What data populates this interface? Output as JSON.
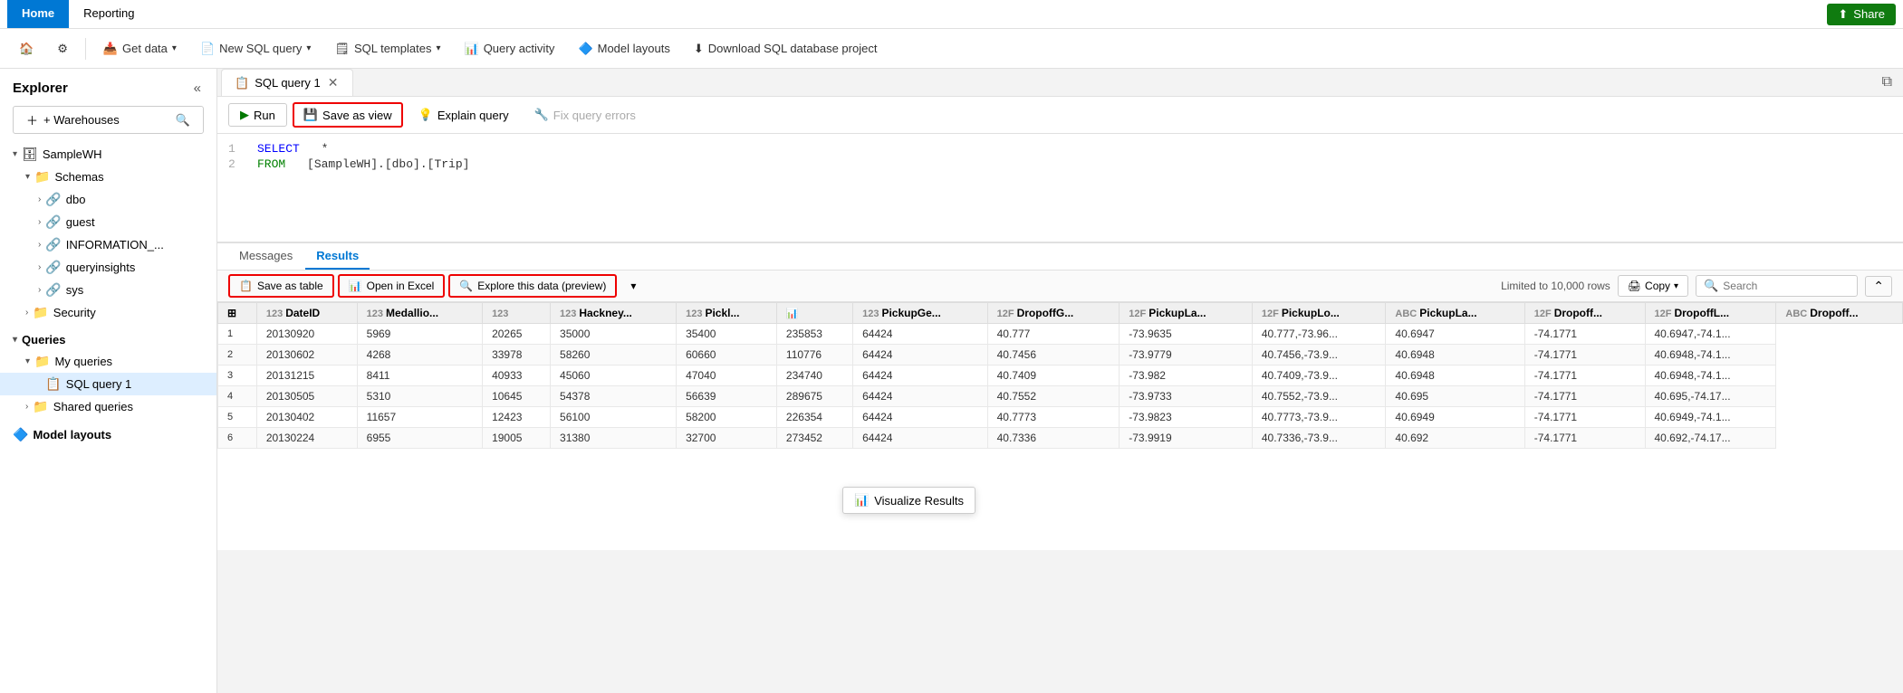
{
  "topbar": {
    "tabs": [
      {
        "label": "Home",
        "active": true
      },
      {
        "label": "Reporting",
        "active": false
      }
    ],
    "share_label": "Share",
    "share_icon": "⬆"
  },
  "toolbar": {
    "items": [
      {
        "id": "home-icon",
        "label": "🏠",
        "type": "icon"
      },
      {
        "id": "settings-icon",
        "label": "⚙",
        "type": "icon"
      },
      {
        "id": "get-data",
        "label": "Get data",
        "icon": "📥",
        "has_chevron": true
      },
      {
        "id": "new-sql",
        "label": "New SQL query",
        "icon": "📄",
        "has_chevron": true
      },
      {
        "id": "sql-templates",
        "label": "SQL templates",
        "icon": "🗒",
        "has_chevron": true
      },
      {
        "id": "query-activity",
        "label": "Query activity",
        "icon": "📊"
      },
      {
        "id": "model-layouts",
        "label": "Model layouts",
        "icon": "🔷"
      },
      {
        "id": "download-sql",
        "label": "Download SQL database project",
        "icon": "⬇"
      }
    ]
  },
  "sidebar": {
    "title": "Explorer",
    "add_warehouse_label": "+ Warehouses",
    "tree": [
      {
        "id": "sampleWH",
        "label": "SampleWH",
        "level": 0,
        "icon": "🗄",
        "expanded": true,
        "type": "warehouse"
      },
      {
        "id": "schemas",
        "label": "Schemas",
        "level": 1,
        "icon": "📁",
        "expanded": true,
        "type": "folder"
      },
      {
        "id": "dbo",
        "label": "dbo",
        "level": 2,
        "icon": "🔗",
        "expanded": false,
        "type": "schema"
      },
      {
        "id": "guest",
        "label": "guest",
        "level": 2,
        "icon": "🔗",
        "expanded": false,
        "type": "schema"
      },
      {
        "id": "information",
        "label": "INFORMATION_...",
        "level": 2,
        "icon": "🔗",
        "expanded": false,
        "type": "schema"
      },
      {
        "id": "queryinsights",
        "label": "queryinsights",
        "level": 2,
        "icon": "🔗",
        "expanded": false,
        "type": "schema"
      },
      {
        "id": "sys",
        "label": "sys",
        "level": 2,
        "icon": "🔗",
        "expanded": false,
        "type": "schema"
      },
      {
        "id": "security",
        "label": "Security",
        "level": 1,
        "icon": "📁",
        "expanded": false,
        "type": "folder"
      },
      {
        "id": "queries",
        "label": "Queries",
        "level": 0,
        "icon": "",
        "expanded": true,
        "type": "section"
      },
      {
        "id": "my-queries",
        "label": "My queries",
        "level": 1,
        "icon": "📁",
        "expanded": true,
        "type": "folder"
      },
      {
        "id": "sql-query-1",
        "label": "SQL query 1",
        "level": 2,
        "icon": "📋",
        "expanded": false,
        "type": "query",
        "selected": true
      },
      {
        "id": "shared-queries",
        "label": "Shared queries",
        "level": 1,
        "icon": "📁",
        "expanded": false,
        "type": "folder"
      },
      {
        "id": "model-layouts-nav",
        "label": "Model layouts",
        "level": 0,
        "icon": "🔷",
        "expanded": false,
        "type": "section"
      }
    ]
  },
  "editor": {
    "tab_label": "SQL query 1",
    "run_label": "Run",
    "save_as_view_label": "Save as view",
    "explain_label": "Explain query",
    "fix_errors_label": "Fix query errors",
    "lines": [
      {
        "num": 1,
        "content": "SELECT *",
        "tokens": [
          {
            "text": "SELECT",
            "type": "keyword"
          },
          {
            "text": " *",
            "type": "normal"
          }
        ]
      },
      {
        "num": 2,
        "content": "FROM [SampleWH].[dbo].[Trip]",
        "tokens": [
          {
            "text": "FROM",
            "type": "keyword2"
          },
          {
            "text": " [SampleWH].[dbo].[Trip]",
            "type": "normal"
          }
        ]
      }
    ]
  },
  "results": {
    "messages_tab": "Messages",
    "results_tab": "Results",
    "save_table_label": "Save as table",
    "open_excel_label": "Open in Excel",
    "explore_label": "Explore this data (preview)",
    "visualize_label": "Visualize Results",
    "limited_label": "Limited to 10,000 rows",
    "copy_label": "Copy",
    "search_placeholder": "Search",
    "columns": [
      {
        "icon": "🔢",
        "label": "DateID"
      },
      {
        "icon": "🔢",
        "label": "Medallio..."
      },
      {
        "icon": "🔢",
        "label": ""
      },
      {
        "icon": "🔢",
        "label": "Hackney..."
      },
      {
        "icon": "🔢",
        "label": "Pickl..."
      },
      {
        "icon": "📊",
        "label": ""
      },
      {
        "icon": "🔢",
        "label": "PickupGe..."
      },
      {
        "icon": "🔢",
        "label": "DropoffG..."
      },
      {
        "icon": "🔡",
        "label": "PickupLa..."
      },
      {
        "icon": "🔡",
        "label": "PickupLo..."
      },
      {
        "icon": "🔡",
        "label": "PickupLa..."
      },
      {
        "icon": "🔡",
        "label": "Dropoff..."
      },
      {
        "icon": "🔡",
        "label": "DropoffL..."
      },
      {
        "icon": "🔡",
        "label": "Dropoff..."
      }
    ],
    "rows": [
      {
        "num": 1,
        "cells": [
          "20130920",
          "5969",
          "20265",
          "35000",
          "35400",
          "235853",
          "64424",
          "40.777",
          "-73.9635",
          "40.777,-73.96...",
          "40.6947",
          "-74.1771",
          "40.6947,-74.1..."
        ]
      },
      {
        "num": 2,
        "cells": [
          "20130602",
          "4268",
          "33978",
          "58260",
          "60660",
          "110776",
          "64424",
          "40.7456",
          "-73.9779",
          "40.7456,-73.9...",
          "40.6948",
          "-74.1771",
          "40.6948,-74.1..."
        ]
      },
      {
        "num": 3,
        "cells": [
          "20131215",
          "8411",
          "40933",
          "45060",
          "47040",
          "234740",
          "64424",
          "40.7409",
          "-73.982",
          "40.7409,-73.9...",
          "40.6948",
          "-74.1771",
          "40.6948,-74.1..."
        ]
      },
      {
        "num": 4,
        "cells": [
          "20130505",
          "5310",
          "10645",
          "54378",
          "56639",
          "289675",
          "64424",
          "40.7552",
          "-73.9733",
          "40.7552,-73.9...",
          "40.695",
          "-74.1771",
          "40.695,-74.17..."
        ]
      },
      {
        "num": 5,
        "cells": [
          "20130402",
          "11657",
          "12423",
          "56100",
          "58200",
          "226354",
          "64424",
          "40.7773",
          "-73.9823",
          "40.7773,-73.9...",
          "40.6949",
          "-74.1771",
          "40.6949,-74.1..."
        ]
      },
      {
        "num": 6,
        "cells": [
          "20130224",
          "6955",
          "19005",
          "31380",
          "32700",
          "273452",
          "64424",
          "40.7336",
          "-73.9919",
          "40.7336,-73.9...",
          "40.692",
          "-74.1771",
          "40.692,-74.17..."
        ]
      }
    ]
  }
}
